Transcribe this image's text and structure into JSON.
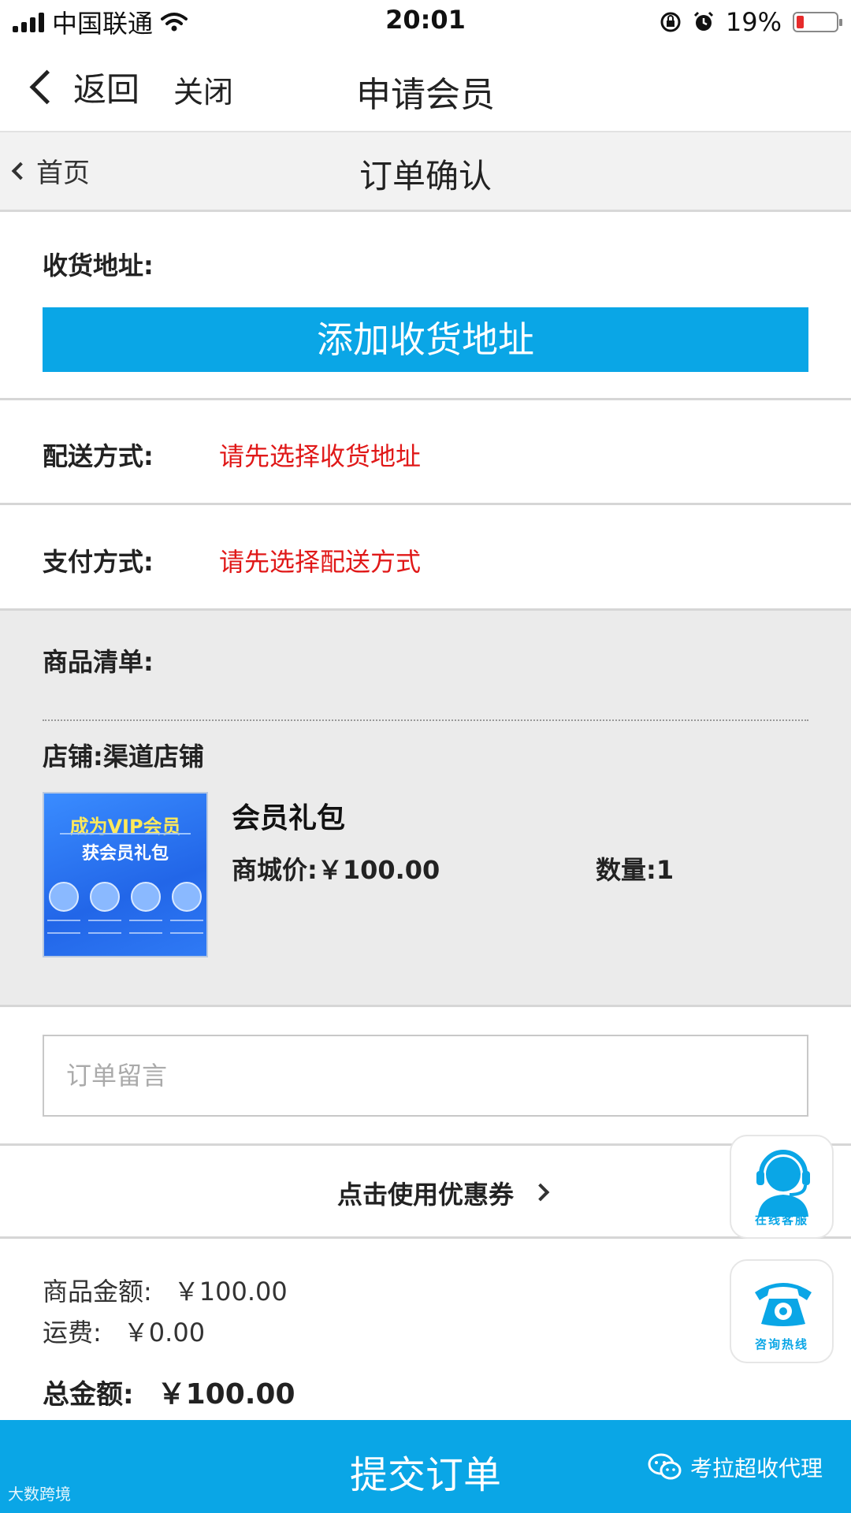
{
  "status_bar": {
    "carrier": "中国联通",
    "time": "20:01",
    "battery_percent": "19%",
    "battery_level": 0.19
  },
  "navbar": {
    "back_label": "返回",
    "close_label": "关闭",
    "title": "申请会员"
  },
  "subheader": {
    "home_label": "首页",
    "title": "订单确认"
  },
  "address": {
    "label": "收货地址:",
    "add_button": "添加收货地址"
  },
  "delivery": {
    "label": "配送方式:",
    "value": "请先选择收货地址"
  },
  "payment": {
    "label": "支付方式:",
    "value": "请先选择配送方式"
  },
  "goods": {
    "label": "商品清单:",
    "store_label": "店铺:",
    "store_name": "渠道店铺",
    "product": {
      "image_line1": "成为VIP会员",
      "image_line2": "获会员礼包",
      "name": "会员礼包",
      "price_label": "商城价:",
      "price": "￥100.00",
      "qty_label": "数量:",
      "qty": "1"
    }
  },
  "remark": {
    "placeholder": "订单留言",
    "value": ""
  },
  "coupon": {
    "label": "点击使用优惠券"
  },
  "amounts": {
    "goods_label": "商品金额:",
    "goods_value": "￥100.00",
    "shipping_label": "运费:",
    "shipping_value": "￥0.00",
    "total_label": "总金额:",
    "total_value": "￥100.00"
  },
  "submit": {
    "label": "提交订单"
  },
  "watermarks": {
    "right": "考拉超收代理",
    "left": "大数跨境"
  },
  "float_buttons": {
    "customer_service": "在线客服",
    "hotline": "咨询热线"
  },
  "colors": {
    "accent": "#0aa6e6",
    "warning_text": "#e01818",
    "goods_bg": "#ebebeb"
  },
  "icons": [
    "signal-icon",
    "wifi-icon",
    "lock-rotation-icon",
    "alarm-icon",
    "battery-icon",
    "chevron-left-icon",
    "chevron-right-icon",
    "headset-agent-icon",
    "telephone-icon",
    "wechat-icon"
  ]
}
